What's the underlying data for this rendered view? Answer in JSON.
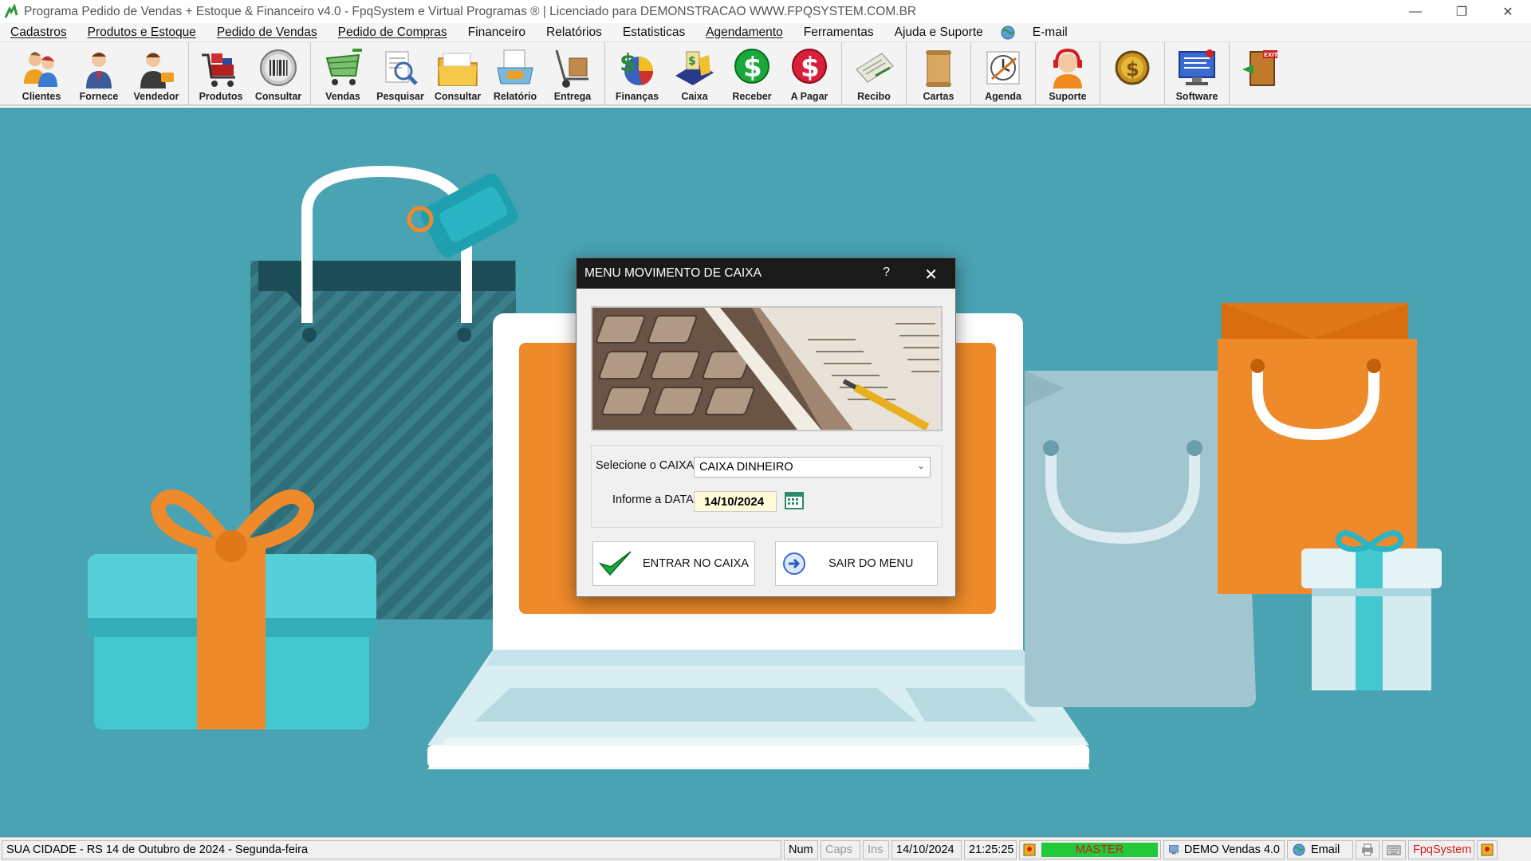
{
  "window": {
    "title": "Programa Pedido de Vendas + Estoque & Financeiro v4.0 - FpqSystem e Virtual Programas ® | Licenciado para  DEMONSTRACAO WWW.FPQSYSTEM.COM.BR",
    "minimize": "—",
    "maximize": "❐",
    "close": "✕"
  },
  "menu": {
    "items": [
      {
        "label": "Cadastros"
      },
      {
        "label": "Produtos e Estoque"
      },
      {
        "label": "Pedido de Vendas"
      },
      {
        "label": "Pedido de Compras"
      },
      {
        "label": "Financeiro"
      },
      {
        "label": "Relatórios"
      },
      {
        "label": "Estatisticas"
      },
      {
        "label": "Agendamento"
      },
      {
        "label": "Ferramentas"
      },
      {
        "label": "Ajuda e Suporte"
      },
      {
        "label": "E-mail"
      }
    ]
  },
  "toolbar": {
    "buttons": [
      {
        "label": "Clientes"
      },
      {
        "label": "Fornece"
      },
      {
        "label": "Vendedor"
      },
      {
        "label": "Produtos"
      },
      {
        "label": "Consultar"
      },
      {
        "label": "Vendas"
      },
      {
        "label": "Pesquisar"
      },
      {
        "label": "Consultar"
      },
      {
        "label": "Relatório"
      },
      {
        "label": "Entrega"
      },
      {
        "label": "Finanças"
      },
      {
        "label": "Caixa"
      },
      {
        "label": "Receber"
      },
      {
        "label": "A Pagar"
      },
      {
        "label": "Recibo"
      },
      {
        "label": "Cartas"
      },
      {
        "label": "Agenda"
      },
      {
        "label": "Suporte"
      },
      {
        "label": ""
      },
      {
        "label": "Software"
      },
      {
        "label": ""
      }
    ],
    "exit_badge": "EXIT"
  },
  "dialog": {
    "title": "MENU MOVIMENTO DE CAIXA",
    "help": "?",
    "close": "✕",
    "caixa_label": "Selecione o CAIXA",
    "caixa_value": "CAIXA DINHEIRO",
    "data_label": "Informe a DATA",
    "data_value": "14/10/2024",
    "enter_button": "ENTRAR NO CAIXA",
    "exit_button": "SAIR DO MENU"
  },
  "status": {
    "location": "SUA CIDADE - RS 14 de Outubro de 2024 - Segunda-feira",
    "num": "Num",
    "caps": "Caps",
    "ins": "Ins",
    "date": "14/10/2024",
    "time": "21:25:25",
    "user": "MASTER",
    "version": "DEMO Vendas 4.0",
    "email": "Email",
    "brand": "FpqSystem"
  },
  "colors": {
    "background": "#4aa3b2",
    "accent_orange": "#ee8a2a",
    "dialog_title": "#1a1a1a",
    "master_green": "#22c93a",
    "brand_red": "#d81a1a"
  }
}
